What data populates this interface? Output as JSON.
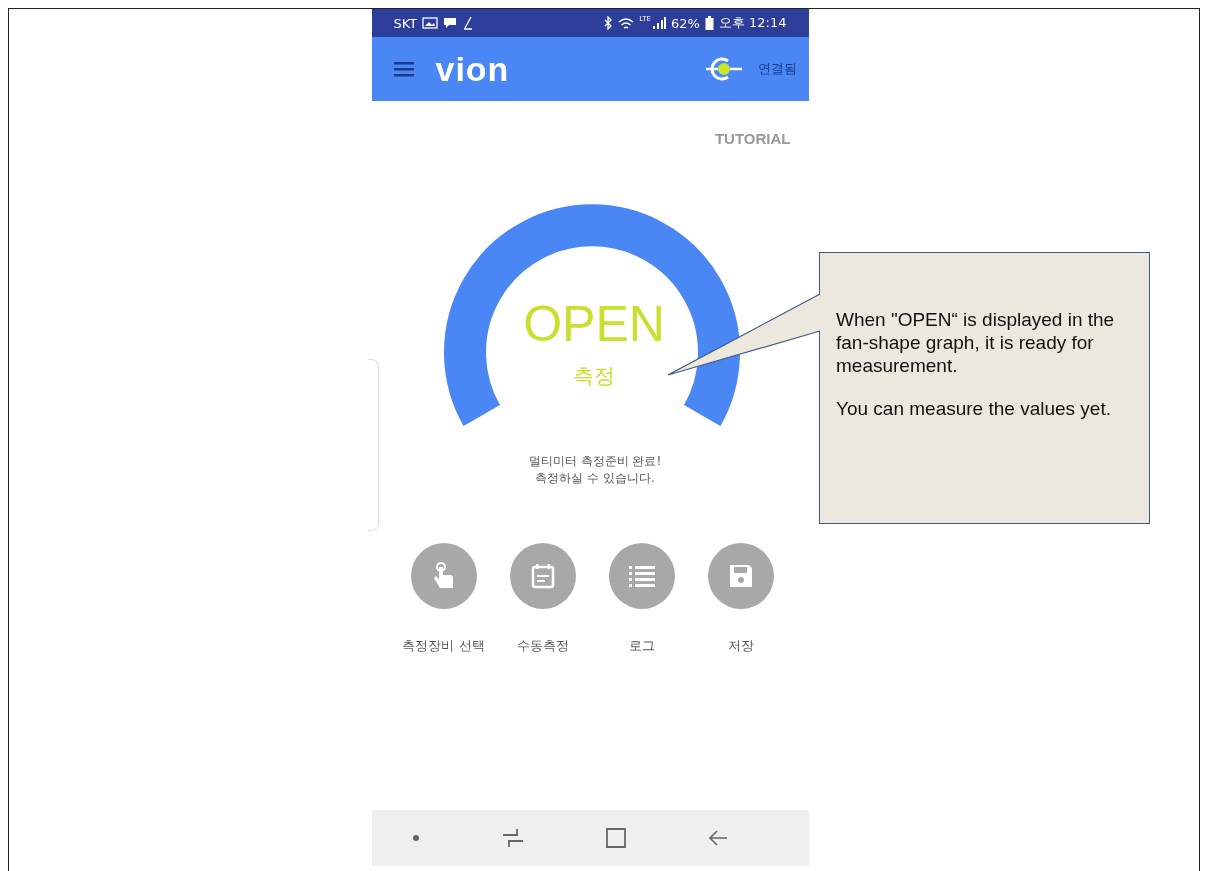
{
  "status_bar": {
    "carrier": "SKT",
    "battery": "62%",
    "network": "LTE",
    "time": "오후 12:14"
  },
  "app_bar": {
    "logo": "vion",
    "connection": "연결됨"
  },
  "tutorial": "TUTORIAL",
  "gauge": {
    "state": "OPEN",
    "mode": "측정"
  },
  "message": [
    "멀티미터 측정준비 완료!",
    "측정하실 수 있습니다."
  ],
  "actions": [
    {
      "kind": "touch",
      "label": "측정장비 선택"
    },
    {
      "kind": "calendar",
      "label": "수동측정"
    },
    {
      "kind": "list",
      "label": "로그"
    },
    {
      "kind": "save",
      "label": "저장"
    }
  ],
  "callout": {
    "paragraphs": [
      "When \"OPEN“  is displayed in the fan-shape graph, it is ready for measurement.",
      "You can measure  the values yet."
    ]
  }
}
